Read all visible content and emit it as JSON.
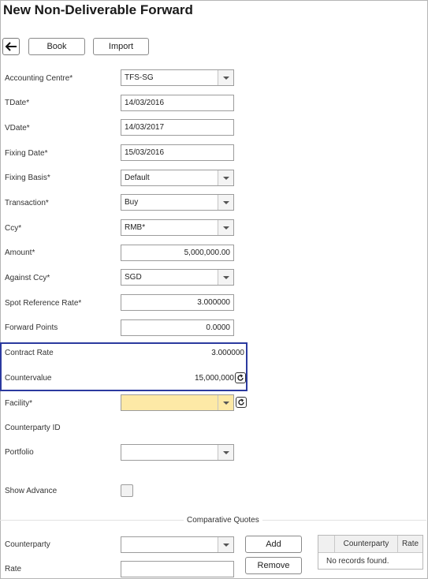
{
  "page": {
    "title": "New Non-Deliverable Forward"
  },
  "toolbar": {
    "book_label": "Book",
    "import_label": "Import"
  },
  "form": {
    "accounting_centre": {
      "label": "Accounting Centre*",
      "value": "TFS-SG"
    },
    "tdate": {
      "label": "TDate*",
      "value": "14/03/2016"
    },
    "vdate": {
      "label": "VDate*",
      "value": "14/03/2017"
    },
    "fixing_date": {
      "label": "Fixing Date*",
      "value": "15/03/2016"
    },
    "fixing_basis": {
      "label": "Fixing Basis*",
      "value": "Default"
    },
    "transaction": {
      "label": "Transaction*",
      "value": "Buy"
    },
    "ccy": {
      "label": "Ccy*",
      "value": "RMB*"
    },
    "amount": {
      "label": "Amount*",
      "value": "5,000,000.00"
    },
    "against_ccy": {
      "label": "Against Ccy*",
      "value": "SGD"
    },
    "spot_reference_rate": {
      "label": "Spot Reference Rate*",
      "value": "3.000000"
    },
    "forward_points": {
      "label": "Forward Points",
      "value": "0.0000"
    },
    "contract_rate": {
      "label": "Contract Rate",
      "value": "3.000000"
    },
    "countervalue": {
      "label": "Countervalue",
      "value": "15,000,000"
    },
    "facility": {
      "label": "Facility*",
      "value": ""
    },
    "counterparty_id": {
      "label": "Counterparty ID"
    },
    "portfolio": {
      "label": "Portfolio",
      "value": ""
    },
    "show_advance": {
      "label": "Show Advance",
      "checked": false
    }
  },
  "comparative_quotes": {
    "title": "Comparative Quotes",
    "counterparty_label": "Counterparty",
    "counterparty_value": "",
    "rate_label": "Rate",
    "rate_value": "",
    "add_label": "Add",
    "remove_label": "Remove",
    "grid": {
      "columns": [
        "Counterparty",
        "Rate"
      ],
      "empty_text": "No records found."
    }
  },
  "colors": {
    "highlight": "#2b3a9f",
    "facility_bg": "#fde9a6"
  },
  "icons": {
    "back": "arrow-left-icon",
    "refresh": "refresh-icon",
    "dropdown": "chevron-down-icon"
  }
}
